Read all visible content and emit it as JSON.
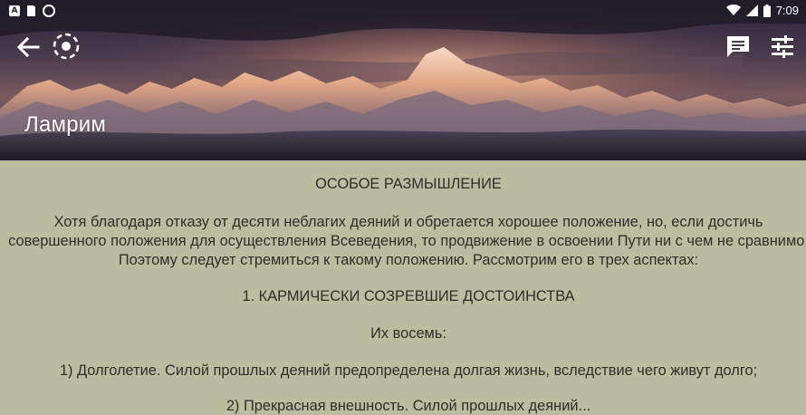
{
  "status_bar": {
    "time": "7:09",
    "left_icons": [
      "app-a-icon",
      "sd-card-icon",
      "circle-notification-icon"
    ],
    "right_icons": [
      "wifi-icon",
      "signal-icon",
      "battery-icon"
    ]
  },
  "toolbar": {
    "title": "Ламрим",
    "actions": [
      "back-arrow-icon",
      "focus-mode-icon",
      "comment-icon",
      "tune-icon"
    ]
  },
  "content": {
    "heading": "ОСОБОЕ РАЗМЫШЛЕНИЕ",
    "paragraph": "Хотя благодаря отказу от десяти неблагих деяний и обретается хорошее положение, но, если достичь совершенного положения для осуществления Всеведения, то продвижение в освоении Пути ни с чем не сравнимо. Поэтому следует стремиться к такому положению. Рассмотрим его в трех аспектах:",
    "subheading": "1. КАРМИЧЕСКИ СОЗРЕВШИЕ ДОСТОИНСТВА",
    "intro": "Их восемь:",
    "item1": "1) Долголетие. Силой прошлых деяний предопределена долгая жизнь, вследствие чего живут долго;",
    "item2": "2) Прекрасная внешность. Силой прошлых деяний..."
  },
  "colors": {
    "content_bg": "#bcbca0",
    "text": "#2e2e2a",
    "header_sky": "#2a2230"
  }
}
